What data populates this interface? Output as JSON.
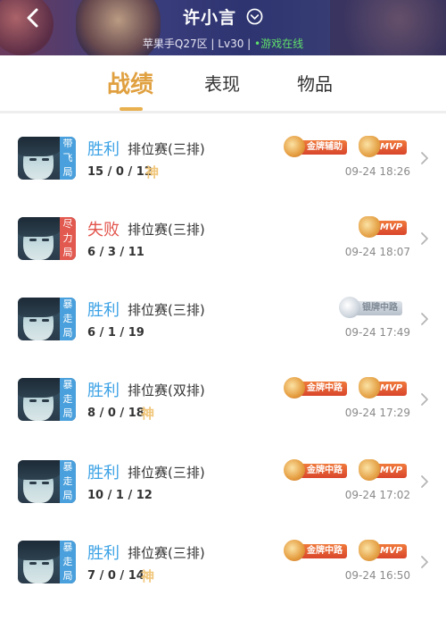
{
  "header": {
    "title": "许小言",
    "server": "苹果手Q27区",
    "level": "Lv30",
    "status": "游戏在线"
  },
  "tabs": [
    {
      "label": "战绩",
      "active": true
    },
    {
      "label": "表现",
      "active": false
    },
    {
      "label": "物品",
      "active": false
    }
  ],
  "matches": [
    {
      "tag": "带飞局",
      "tag_color": "#4aa0dc",
      "result": "胜利",
      "result_type": "win",
      "mode": "排位赛(三排)",
      "kda": "15 / 0 / 12",
      "god": "神",
      "badges": [
        {
          "kind": "gold",
          "label": "金牌辅助"
        },
        {
          "kind": "mvp",
          "label": "MVP"
        }
      ],
      "time": "09-24 18:26"
    },
    {
      "tag": "尽力局",
      "tag_color": "#e2594f",
      "result": "失败",
      "result_type": "lose",
      "mode": "排位赛(三排)",
      "kda": "6 / 3 / 11",
      "god": "",
      "badges": [
        {
          "kind": "mvp",
          "label": "MVP"
        }
      ],
      "time": "09-24 18:07"
    },
    {
      "tag": "暴走局",
      "tag_color": "#4aa0dc",
      "result": "胜利",
      "result_type": "win",
      "mode": "排位赛(三排)",
      "kda": "6 / 1 / 19",
      "god": "",
      "badges": [
        {
          "kind": "silver",
          "label": "银牌中路"
        }
      ],
      "time": "09-24 17:49"
    },
    {
      "tag": "暴走局",
      "tag_color": "#4aa0dc",
      "result": "胜利",
      "result_type": "win",
      "mode": "排位赛(双排)",
      "kda": "8 / 0 / 18",
      "god": "神",
      "badges": [
        {
          "kind": "gold",
          "label": "金牌中路"
        },
        {
          "kind": "mvp",
          "label": "MVP"
        }
      ],
      "time": "09-24 17:29"
    },
    {
      "tag": "暴走局",
      "tag_color": "#4aa0dc",
      "result": "胜利",
      "result_type": "win",
      "mode": "排位赛(三排)",
      "kda": "10 / 1 / 12",
      "god": "",
      "badges": [
        {
          "kind": "gold",
          "label": "金牌中路"
        },
        {
          "kind": "mvp",
          "label": "MVP"
        }
      ],
      "time": "09-24 17:02"
    },
    {
      "tag": "暴走局",
      "tag_color": "#4aa0dc",
      "result": "胜利",
      "result_type": "win",
      "mode": "排位赛(三排)",
      "kda": "7 / 0 / 14",
      "god": "神",
      "badges": [
        {
          "kind": "gold",
          "label": "金牌中路"
        },
        {
          "kind": "mvp",
          "label": "MVP"
        }
      ],
      "time": "09-24 16:50"
    }
  ],
  "colors": {
    "accent": "#e0a040",
    "win": "#3ea3e6",
    "lose": "#e2544b"
  },
  "icons": {
    "back": "back-chevron-icon",
    "dropdown": "chevron-down-circle-icon",
    "row_arrow": "chevron-right-icon"
  }
}
